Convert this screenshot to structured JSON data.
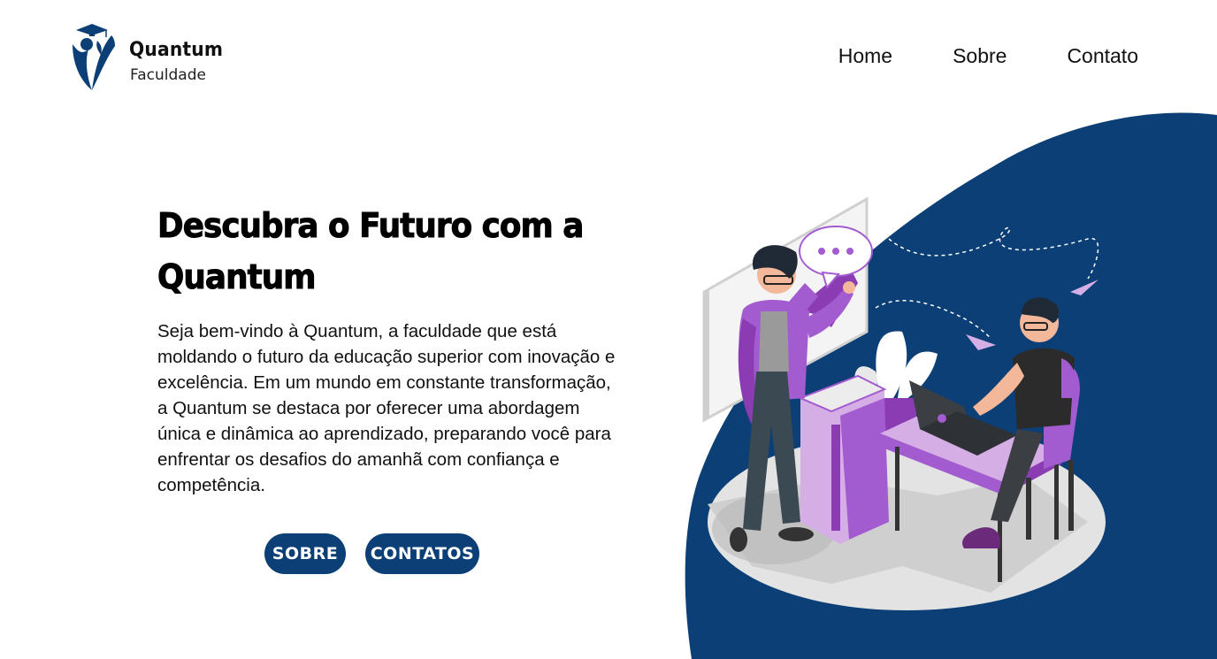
{
  "header": {
    "logo": {
      "title": "Quantum",
      "subtitle": "Faculdade"
    },
    "nav": [
      {
        "label": "Home"
      },
      {
        "label": "Sobre"
      },
      {
        "label": "Contato"
      }
    ]
  },
  "hero": {
    "title": "Descubra o Futuro com a Quantum",
    "description": "Seja bem-vindo à Quantum, a faculdade que está moldando o futuro da educação superior com inovação e excelência. Em um mundo em constante transformação, a Quantum se destaca por oferecer uma abordagem única e dinâmica ao aprendizado, preparando você para enfrentar os desafios do amanhã com confiança e competência.",
    "buttons": {
      "sobre": "SOBRE",
      "contatos": "CONTATOS"
    }
  },
  "colors": {
    "brand": "#0b3f76",
    "accent_purple": "#a35bd0",
    "light_purple": "#d6aee6"
  },
  "icons": {
    "logo": "graduate-cap-logo-icon",
    "speech_bubble": "speech-bubble-icon",
    "paper_plane": "paper-plane-icon"
  }
}
